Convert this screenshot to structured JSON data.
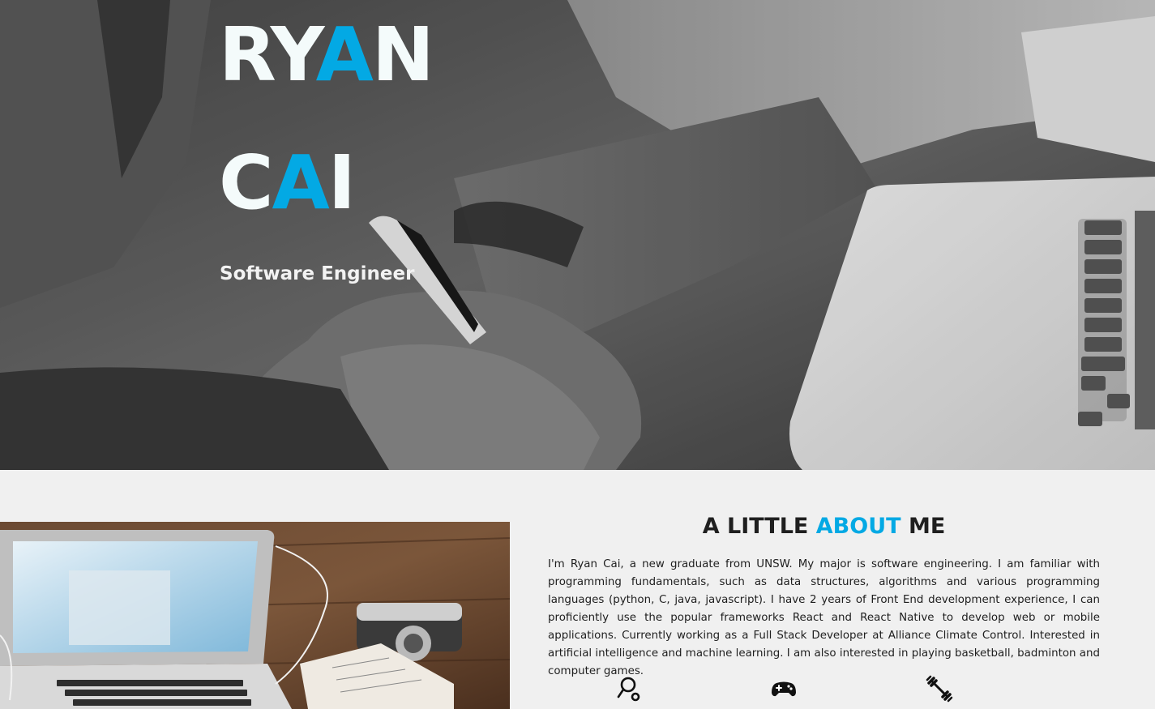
{
  "hero": {
    "first_name_a": "RY",
    "first_name_accent": "A",
    "first_name_b": "N",
    "last_name_a": "C",
    "last_name_accent": "A",
    "last_name_b": "I",
    "role": "Software Engineer"
  },
  "about": {
    "title_a": "A LITTLE",
    "title_accent": "ABOUT",
    "title_b": "ME",
    "text": "I'm Ryan Cai, a new graduate from UNSW. My major is software engineering. I am familiar with programming fundamentals, such as data structures, algorithms and various programming languages (python, C, java, javascript). I have 2 years of Front End development experience, I can proficiently use the popular frameworks React and React Native to develop web or mobile applications. Currently working as a Full Stack Developer at Alliance Climate Control. Interested in artificial intelligence and machine learning. I am also interested in playing basketball, badminton and computer games.",
    "hobbies": [
      "badminton-icon",
      "gamepad-icon",
      "dumbbell-icon"
    ]
  },
  "colors": {
    "accent": "#03a9e4",
    "hero_text": "#f4fbfb",
    "background": "#f0f0f0",
    "body_text": "#1e1e1e"
  }
}
